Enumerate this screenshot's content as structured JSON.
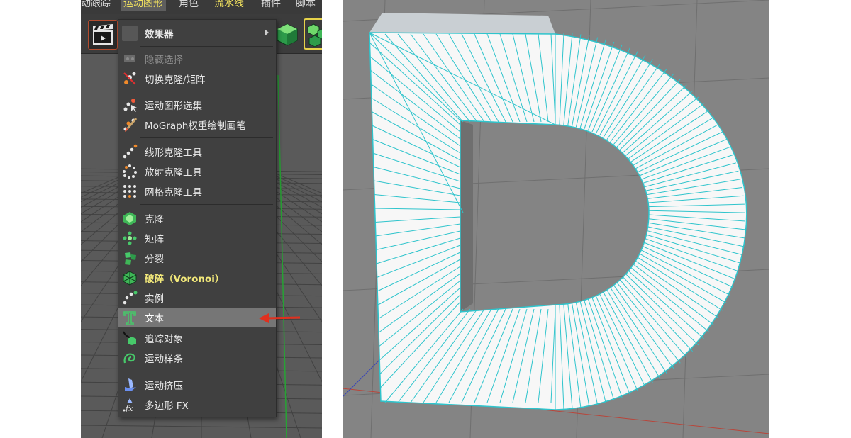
{
  "menubar": {
    "items": [
      "动跟踪",
      "运动图形",
      "角色",
      "流水线",
      "插件",
      "脚本"
    ]
  },
  "toolbar": {
    "clapper_icon": "clapperboard-icon",
    "cube_icons": [
      "green-cube-icon",
      "green-cube-cluster-icon"
    ]
  },
  "menu": {
    "effector_label": "效果器",
    "items": [
      {
        "label": "隐藏选择",
        "icon": "hide-selection-icon",
        "state": "disabled"
      },
      {
        "label": "切换克隆/矩阵",
        "icon": "toggle-clone-icon",
        "state": "normal"
      },
      {
        "label": "运动图形选集",
        "icon": "mograph-selection-icon",
        "state": "normal"
      },
      {
        "label": "MoGraph权重绘制画笔",
        "icon": "weight-paint-brush-icon",
        "state": "normal"
      },
      {
        "label": "线形克隆工具",
        "icon": "linear-clone-icon",
        "state": "normal"
      },
      {
        "label": "放射克隆工具",
        "icon": "radial-clone-icon",
        "state": "normal"
      },
      {
        "label": "网格克隆工具",
        "icon": "grid-clone-icon",
        "state": "normal"
      },
      {
        "label": "克隆",
        "icon": "cloner-icon",
        "state": "normal"
      },
      {
        "label": "矩阵",
        "icon": "matrix-icon",
        "state": "normal"
      },
      {
        "label": "分裂",
        "icon": "fracture-icon",
        "state": "normal"
      },
      {
        "label": "破碎（Voronoi）",
        "icon": "voronoi-fracture-icon",
        "state": "bold"
      },
      {
        "label": "实例",
        "icon": "instance-icon",
        "state": "normal"
      },
      {
        "label": "文本",
        "icon": "text-t-icon",
        "state": "highlighted"
      },
      {
        "label": "追踪对象",
        "icon": "tracer-icon",
        "state": "normal"
      },
      {
        "label": "运动样条",
        "icon": "motion-spline-icon",
        "state": "normal"
      },
      {
        "label": "运动挤压",
        "icon": "mo-extrude-icon",
        "state": "normal"
      },
      {
        "label": "多边形 FX",
        "icon": "polygon-fx-icon",
        "state": "normal"
      }
    ]
  },
  "annotation": {
    "arrow_icon": "red-arrow-icon",
    "color": "#e0301e"
  },
  "colors": {
    "menu_bg": "#404040",
    "highlight": "#767676",
    "accent_yellow": "#f3e97a",
    "icon_green": "#47c96a",
    "wireframe": "#2ec4cc",
    "viewport_bg": "#848484"
  },
  "viewport3d": {
    "object_letter": "D",
    "object_icon": "extruded-letter-d-icon"
  }
}
